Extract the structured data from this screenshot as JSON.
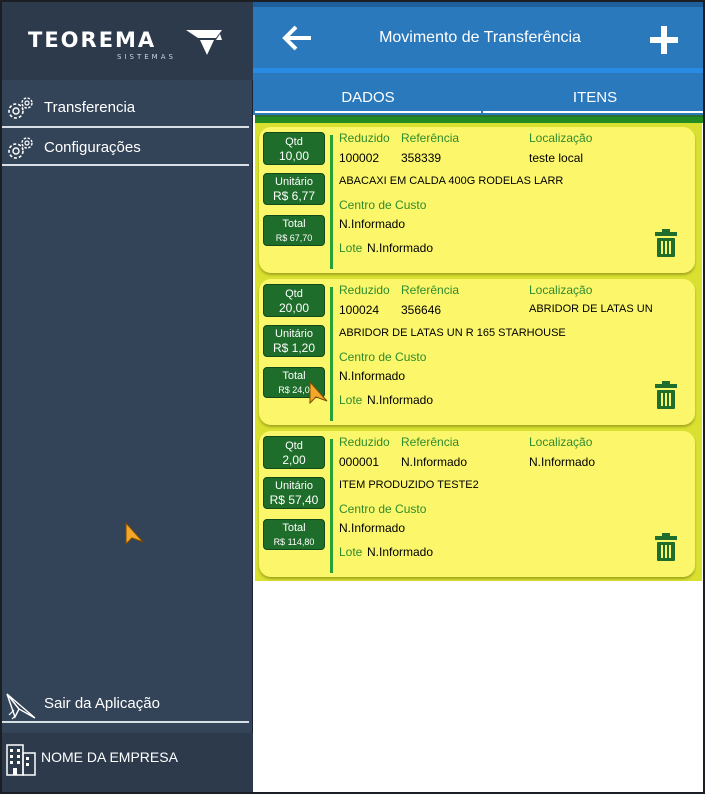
{
  "brand": {
    "name": "TEOREMA",
    "subtitle": "SISTEMAS"
  },
  "sidebar": {
    "items": [
      {
        "label": "Transferencia",
        "icon": "gear-icon"
      },
      {
        "label": "Configurações",
        "icon": "gear-icon"
      }
    ],
    "exit_label": "Sair da Aplicação",
    "company_label": "NOME DA EMPRESA"
  },
  "header": {
    "title": "Movimento de Transferência"
  },
  "tabs": [
    {
      "label": "DADOS"
    },
    {
      "label": "ITENS"
    }
  ],
  "field_labels": {
    "qtd": "Qtd",
    "unitario": "Unitário",
    "total": "Total",
    "reduzido": "Reduzido",
    "referencia": "Referência",
    "localizacao": "Localização",
    "centro_custo": "Centro de Custo",
    "lote": "Lote"
  },
  "items": [
    {
      "qtd": "10,00",
      "unitario": "R$ 6,77",
      "total": "R$ 67,70",
      "reduzido": "100002",
      "referencia": "358339",
      "localizacao": "teste local",
      "descricao": "ABACAXI EM CALDA 400G RODELAS LARR",
      "centro_custo": "N.Informado",
      "lote": "N.Informado"
    },
    {
      "qtd": "20,00",
      "unitario": "R$ 1,20",
      "total": "R$ 24,0",
      "reduzido": "100024",
      "referencia": "356646",
      "localizacao": "ABRIDOR DE LATAS UN",
      "descricao": "ABRIDOR DE LATAS UN R 165 STARHOUSE",
      "centro_custo": "N.Informado",
      "lote": "N.Informado"
    },
    {
      "qtd": "2,00",
      "unitario": "R$ 57,40",
      "total": "R$ 114,80",
      "reduzido": "000001",
      "referencia": "N.Informado",
      "localizacao": "N.Informado",
      "descricao": "ITEM PRODUZIDO TESTE2",
      "centro_custo": "N.Informado",
      "lote": "N.Informado"
    }
  ],
  "colors": {
    "sidebar": "#344458",
    "appbar": "#2b79bd",
    "card": "#fcf76a",
    "pill": "#1f6d2b",
    "label_green": "#2e8b2e"
  }
}
